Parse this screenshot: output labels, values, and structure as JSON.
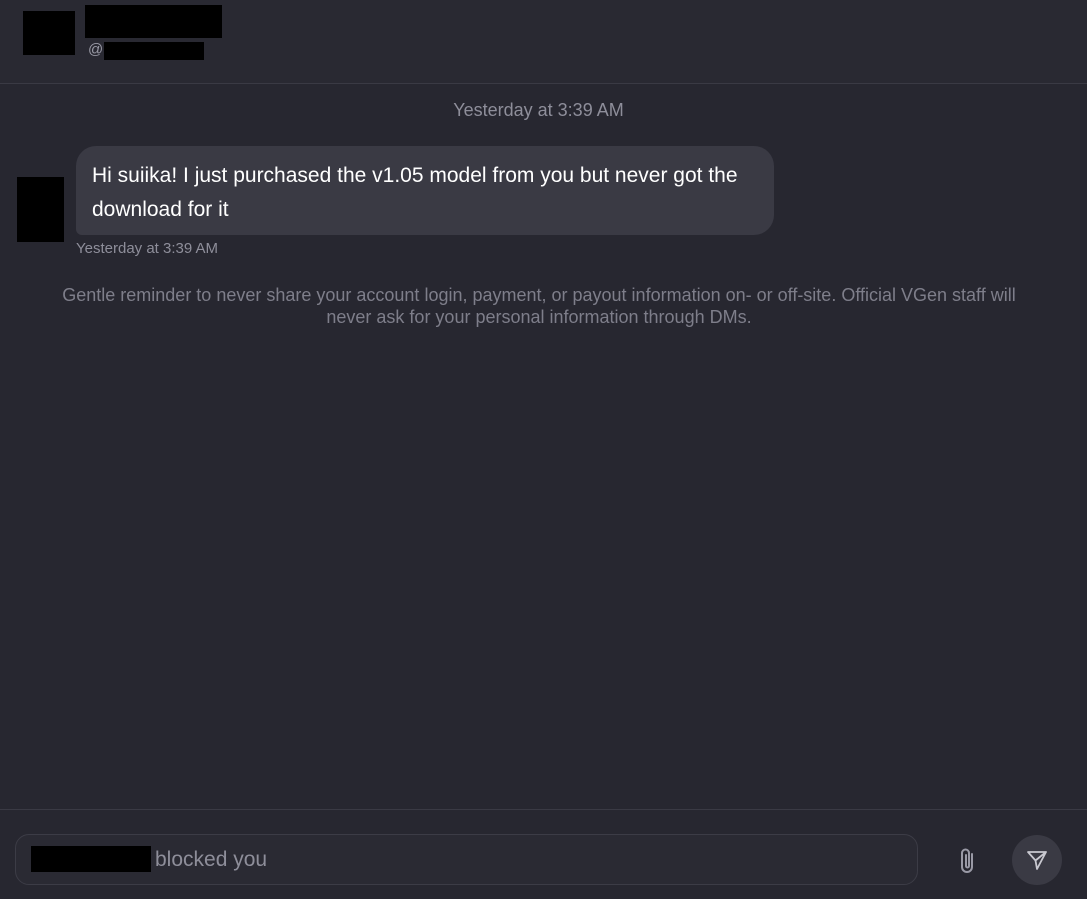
{
  "header": {
    "handle_prefix": "@"
  },
  "conversation": {
    "date_divider": "Yesterday at 3:39 AM",
    "messages": [
      {
        "text": "Hi suiika! I just purchased the v1.05 model from you but never got the download for it",
        "time": "Yesterday at 3:39 AM"
      }
    ],
    "safety_notice": "Gentle reminder to never share your account login, payment, or payout information on- or off-site. Official VGen staff will never ask for your personal information through DMs."
  },
  "composer": {
    "status_text": "blocked you",
    "attach_icon": "paperclip-icon",
    "send_icon": "send-icon"
  },
  "colors": {
    "background": "#272730",
    "bubble": "#3a3a44",
    "muted_text": "#8e8e9a"
  }
}
